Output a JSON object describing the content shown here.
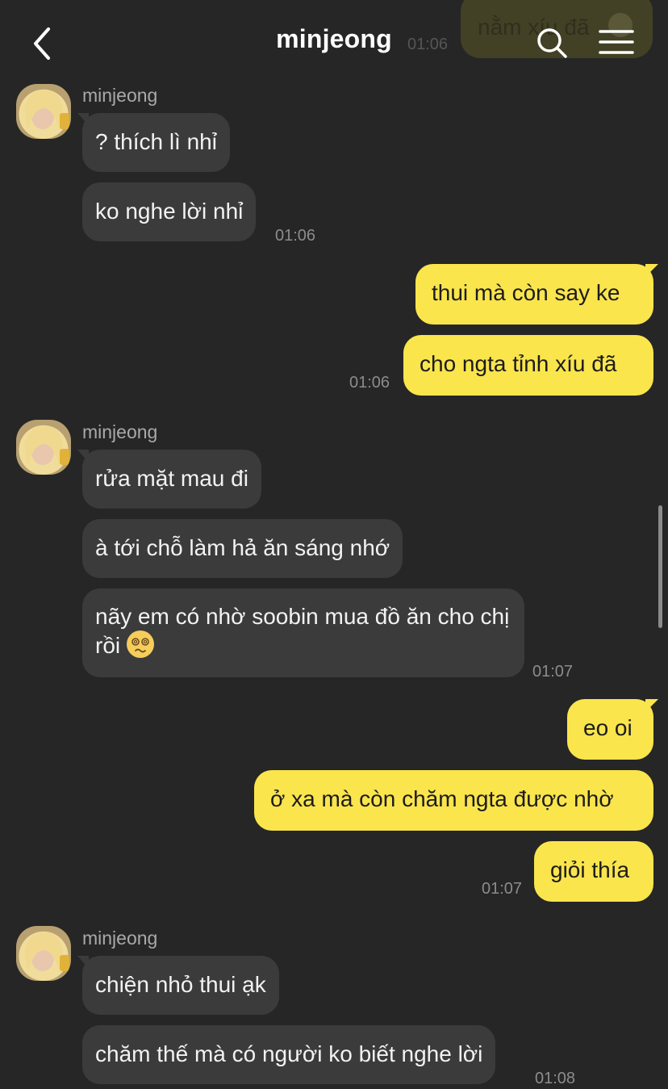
{
  "header": {
    "title": "minjeong"
  },
  "peek": {
    "text": "nằm xíu đã",
    "time": "01:06"
  },
  "groups": [
    {
      "sender": "minjeong",
      "messages": [
        "? thích lì nhỉ",
        "ko nghe lời nhỉ"
      ],
      "time": "01:06"
    },
    {
      "messages": [
        "thui mà còn say ke",
        "cho ngta tỉnh xíu đã"
      ],
      "time": "01:06"
    },
    {
      "sender": "minjeong",
      "messages": [
        "rửa mặt mau đi",
        "à tới chỗ làm hả ăn sáng nhớ",
        "nãy em có nhờ soobin mua đồ ăn cho chị rồi"
      ],
      "time": "01:07"
    },
    {
      "messages": [
        "eo oi",
        "ở xa mà còn chăm ngta được nhờ",
        "giỏi thía"
      ],
      "time": "01:07"
    },
    {
      "sender": "minjeong",
      "messages": [
        "chiện nhỏ thui ạk",
        "chăm thế mà có người ko biết nghe lời"
      ],
      "time": "01:08"
    }
  ],
  "icons": {
    "back": "chevron-left-icon",
    "search": "search-icon",
    "menu": "hamburger-menu-icon",
    "emoji": "dizzy-face-emoji"
  },
  "colors": {
    "background": "#262626",
    "incoming_bubble": "#3b3b3b",
    "outgoing_bubble": "#fae54d",
    "timestamp": "#8c8c8c"
  }
}
